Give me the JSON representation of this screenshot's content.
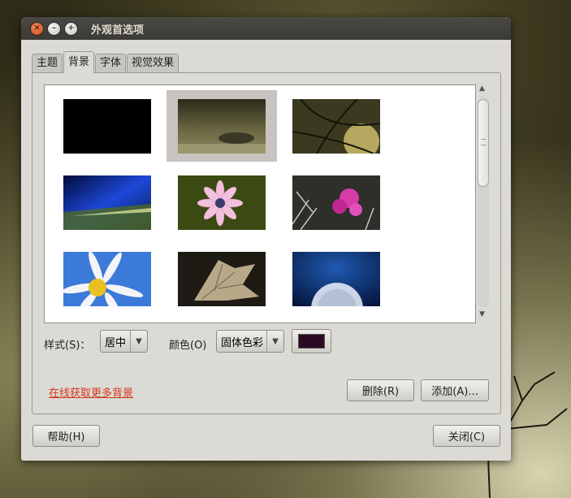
{
  "window": {
    "title": "外观首选项",
    "controls": [
      "close-icon",
      "minimize-icon",
      "maximize-icon"
    ]
  },
  "tabs": [
    {
      "label": "主题",
      "active": false
    },
    {
      "label": "背景",
      "active": true
    },
    {
      "label": "字体",
      "active": false
    },
    {
      "label": "视觉效果",
      "active": false
    }
  ],
  "gallery": {
    "thumbnails": [
      {
        "name": "solid-black-wallpaper",
        "selected": false
      },
      {
        "name": "dark-lake-clouds-wallpaper",
        "selected": true
      },
      {
        "name": "tree-branches-wallpaper",
        "selected": false
      },
      {
        "name": "blue-light-streak-wallpaper",
        "selected": false
      },
      {
        "name": "pink-daisy-wallpaper",
        "selected": false
      },
      {
        "name": "magenta-flower-wallpaper",
        "selected": false
      },
      {
        "name": "white-daisy-wallpaper",
        "selected": false
      },
      {
        "name": "dewy-leaf-wallpaper",
        "selected": false
      },
      {
        "name": "dandelion-wallpaper",
        "selected": false
      }
    ]
  },
  "options": {
    "style_label": "样式(S)：",
    "style_value": "居中",
    "color_label": "颜色(O)",
    "color_value": "固体色彩",
    "swatch_color": "#2a0a22"
  },
  "links": {
    "more_backgrounds": "在线获取更多背景"
  },
  "buttons": {
    "delete": "删除(R)",
    "add": "添加(A)...",
    "help": "帮助(H)",
    "close": "关闭(C)"
  }
}
